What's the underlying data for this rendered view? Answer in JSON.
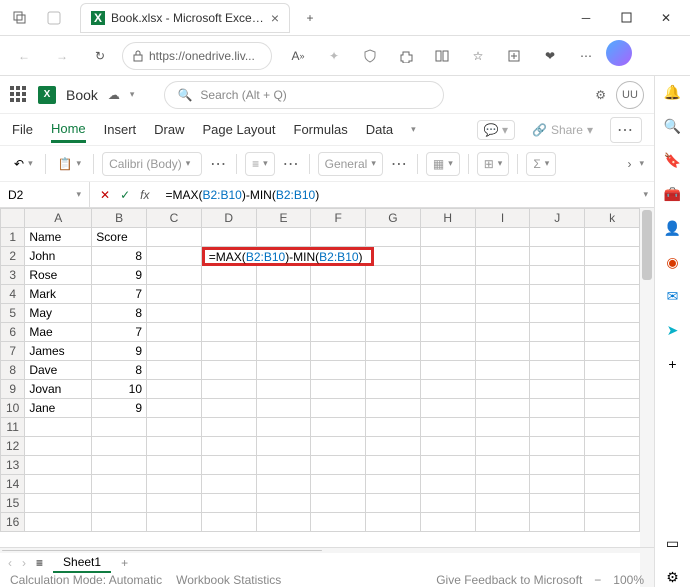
{
  "browser": {
    "tab_title": "Book.xlsx - Microsoft Excel Onli",
    "url_display": "https://onedrive.liv...",
    "font_label": "A"
  },
  "app": {
    "doc_name": "Book",
    "search_placeholder": "Search (Alt + Q)",
    "avatar_initials": "UU"
  },
  "ribbon": {
    "tabs": [
      "File",
      "Home",
      "Insert",
      "Draw",
      "Page Layout",
      "Formulas",
      "Data"
    ],
    "active": "Home",
    "share_label": "Share"
  },
  "toolbar": {
    "font_family": "Calibri (Body)",
    "number_format": "General"
  },
  "formula_bar": {
    "namebox": "D2",
    "formula_prefix": "=MAX(",
    "formula_ref1": "B2:B10",
    "formula_mid": ")-MIN(",
    "formula_ref2": "B2:B10",
    "formula_suffix": ")"
  },
  "grid": {
    "columns": [
      "A",
      "B",
      "C",
      "D",
      "E",
      "F",
      "G",
      "H",
      "I",
      "J",
      "k"
    ],
    "headers": {
      "A": "Name",
      "B": "Score"
    },
    "rows": [
      {
        "n": 1,
        "A": "Name",
        "B": "Score",
        "B_num": false
      },
      {
        "n": 2,
        "A": "John",
        "B": "8",
        "B_num": true,
        "formula_cell": true
      },
      {
        "n": 3,
        "A": "Rose",
        "B": "9",
        "B_num": true
      },
      {
        "n": 4,
        "A": "Mark",
        "B": "7",
        "B_num": true
      },
      {
        "n": 5,
        "A": "May",
        "B": "8",
        "B_num": true
      },
      {
        "n": 6,
        "A": "Mae",
        "B": "7",
        "B_num": true
      },
      {
        "n": 7,
        "A": "James",
        "B": "9",
        "B_num": true
      },
      {
        "n": 8,
        "A": "Dave",
        "B": "8",
        "B_num": true
      },
      {
        "n": 9,
        "A": "Jovan",
        "B": "10",
        "B_num": true
      },
      {
        "n": 10,
        "A": "Jane",
        "B": "9",
        "B_num": true
      },
      {
        "n": 11
      },
      {
        "n": 12
      },
      {
        "n": 13
      },
      {
        "n": 14
      },
      {
        "n": 15
      },
      {
        "n": 16
      }
    ],
    "formula_display": {
      "prefix": "=MAX(",
      "ref1": "B2:B10",
      "mid": ")-MIN(",
      "ref2": "B2:B10",
      "suffix": ")"
    }
  },
  "sheets": {
    "active": "Sheet1"
  },
  "status": {
    "calc_mode": "Calculation Mode: Automatic",
    "wb_stats": "Workbook Statistics",
    "feedback": "Give Feedback to Microsoft",
    "zoom": "100%"
  }
}
